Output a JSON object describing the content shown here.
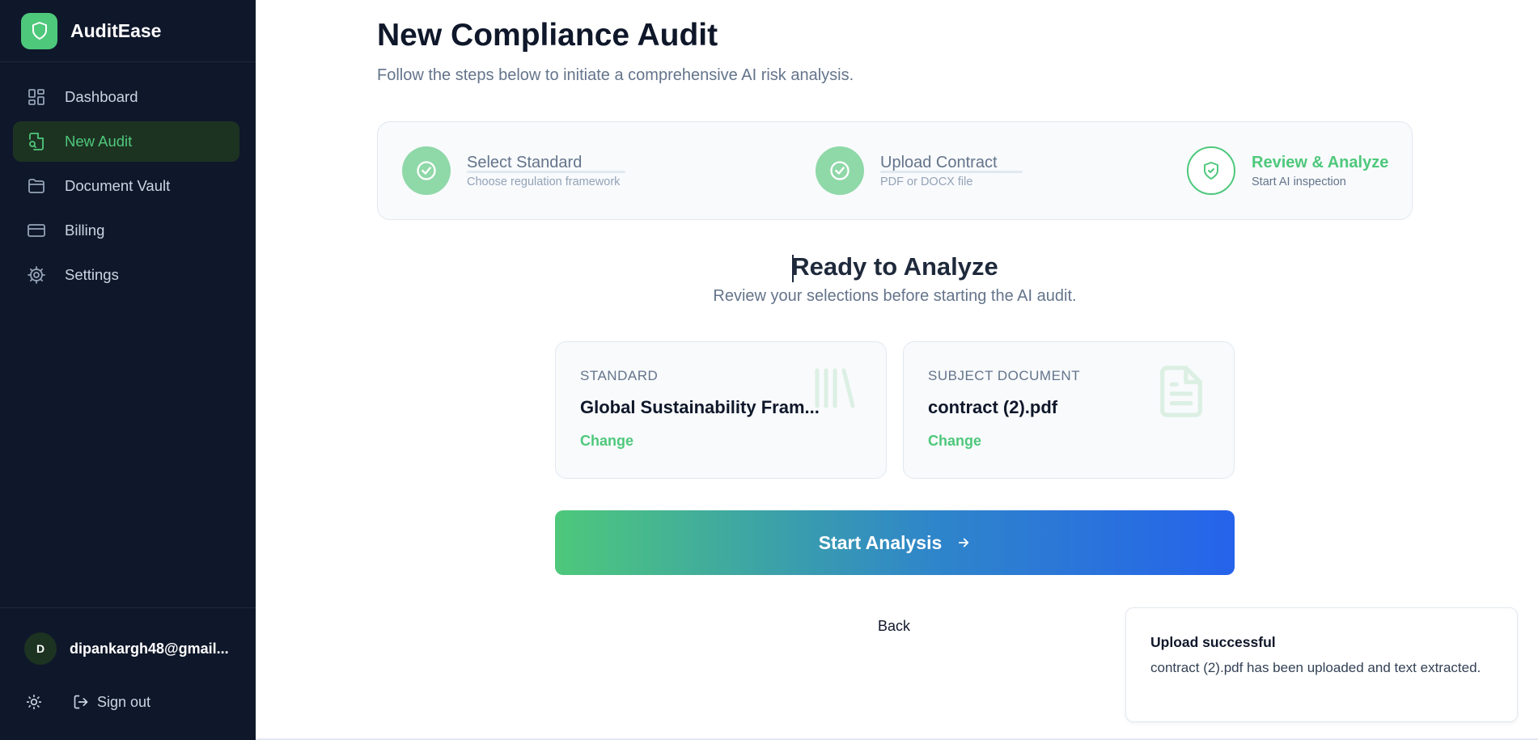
{
  "app": {
    "name": "AuditEase"
  },
  "sidebar": {
    "items": [
      {
        "label": "Dashboard",
        "icon": "dashboard-icon",
        "active": false
      },
      {
        "label": "New Audit",
        "icon": "file-search-icon",
        "active": true
      },
      {
        "label": "Document Vault",
        "icon": "folder-icon",
        "active": false
      },
      {
        "label": "Billing",
        "icon": "credit-card-icon",
        "active": false
      },
      {
        "label": "Settings",
        "icon": "gear-icon",
        "active": false
      }
    ],
    "user": {
      "initial": "D",
      "email": "dipankargh48@gmail..."
    },
    "signout_label": "Sign out"
  },
  "header": {
    "title": "New Compliance Audit",
    "subtitle": "Follow the steps below to initiate a comprehensive AI risk analysis."
  },
  "stepper": {
    "steps": [
      {
        "title": "Select Standard",
        "description": "Choose regulation framework",
        "status": "done"
      },
      {
        "title": "Upload Contract",
        "description": "PDF or DOCX file",
        "status": "done"
      },
      {
        "title": "Review & Analyze",
        "description": "Start AI inspection",
        "status": "current"
      }
    ]
  },
  "review": {
    "title": "Ready to Analyze",
    "subtitle": "Review your selections before starting the AI audit.",
    "cards": [
      {
        "label": "STANDARD",
        "value": "Global Sustainability Fram...",
        "change_label": "Change",
        "icon": "library-icon"
      },
      {
        "label": "SUBJECT DOCUMENT",
        "value": "contract (2).pdf",
        "change_label": "Change",
        "icon": "document-icon"
      }
    ],
    "start_label": "Start Analysis",
    "back_label": "Back"
  },
  "toast": {
    "title": "Upload successful",
    "message": "contract (2).pdf has been uploaded and text extracted."
  },
  "colors": {
    "sidebar_bg": "#0f172a",
    "accent": "#4ec87b",
    "gradient_end": "#2563eb"
  }
}
